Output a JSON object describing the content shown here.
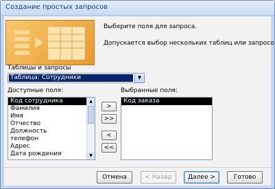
{
  "window": {
    "title": "Создание простых запросов"
  },
  "intro": {
    "line1": "Выберите поля для запроса.",
    "line2": "Допускается выбор нескольких таблиц или запросов."
  },
  "tables": {
    "label": "Таблицы и запросы",
    "selected": "Таблица: Сотрудники"
  },
  "available": {
    "label": "Доступные поля:",
    "items": [
      "Код сотрудника",
      "Фамилия",
      "Имя",
      "Отчество",
      "Должность",
      "телефон",
      "Адрес",
      "Дата рождения"
    ],
    "selected_index": 0
  },
  "chosen": {
    "label": "Выбранные поля:",
    "items": [
      "Код заказа"
    ]
  },
  "move_buttons": {
    "add_one": ">",
    "add_all": ">>",
    "remove_one": "<",
    "remove_all": "<<"
  },
  "buttons": {
    "cancel": "Отмена",
    "back": "< Назад",
    "next": "Далее >",
    "finish": "Готово"
  },
  "icons": {
    "combo": "chevron-down-icon",
    "scroll_up": "arrow-up-icon",
    "scroll_down": "arrow-down-icon"
  },
  "colors": {
    "accent": "#15428b",
    "selection": "#0a246a",
    "graphic": "#e89a2f"
  }
}
